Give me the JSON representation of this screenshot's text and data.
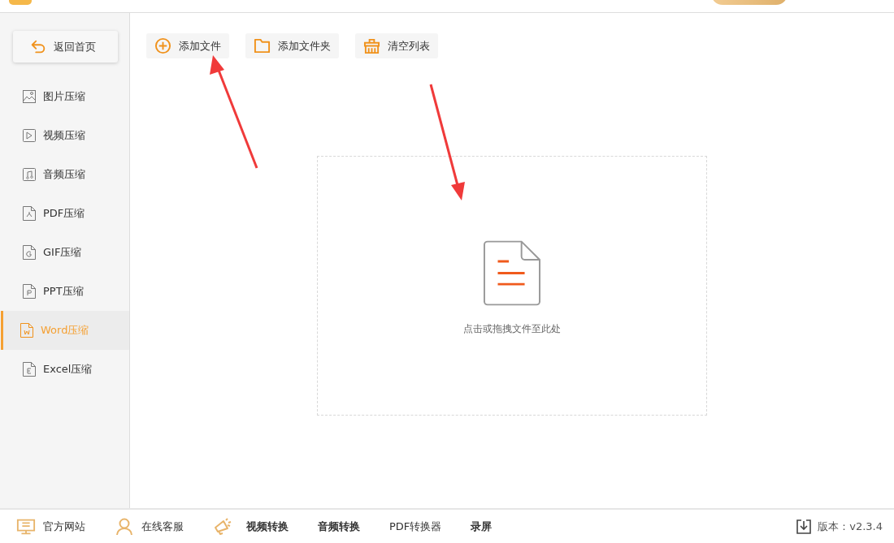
{
  "back_button": {
    "label": "返回首页"
  },
  "sidebar": {
    "items": [
      {
        "label": "图片压缩",
        "kind": "image",
        "selected": false
      },
      {
        "label": "视频压缩",
        "kind": "video",
        "selected": false
      },
      {
        "label": "音频压缩",
        "kind": "audio",
        "selected": false
      },
      {
        "label": "PDF压缩",
        "kind": "pdf",
        "selected": false
      },
      {
        "label": "GIF压缩",
        "kind": "gif",
        "selected": false
      },
      {
        "label": "PPT压缩",
        "kind": "ppt",
        "selected": false
      },
      {
        "label": "Word压缩",
        "kind": "word",
        "selected": true
      },
      {
        "label": "Excel压缩",
        "kind": "excel",
        "selected": false
      }
    ]
  },
  "toolbar": [
    {
      "label": "添加文件",
      "kind": "add"
    },
    {
      "label": "添加文件夹",
      "kind": "folder"
    },
    {
      "label": "清空列表",
      "kind": "clear"
    }
  ],
  "drop_zone": {
    "hint": "点击或拖拽文件至此处"
  },
  "footer": {
    "links": [
      {
        "label": "官方网站",
        "kind": "site",
        "bold": false
      },
      {
        "label": "在线客服",
        "kind": "service",
        "bold": false
      },
      {
        "label": "视频转换",
        "kind": "promo",
        "bold": true
      },
      {
        "label": "音频转换",
        "kind": "plain",
        "bold": true
      },
      {
        "label": "PDF转换器",
        "kind": "plain",
        "bold": false
      },
      {
        "label": "录屏",
        "kind": "plain",
        "bold": true
      }
    ],
    "version": "版本：v2.3.4"
  }
}
